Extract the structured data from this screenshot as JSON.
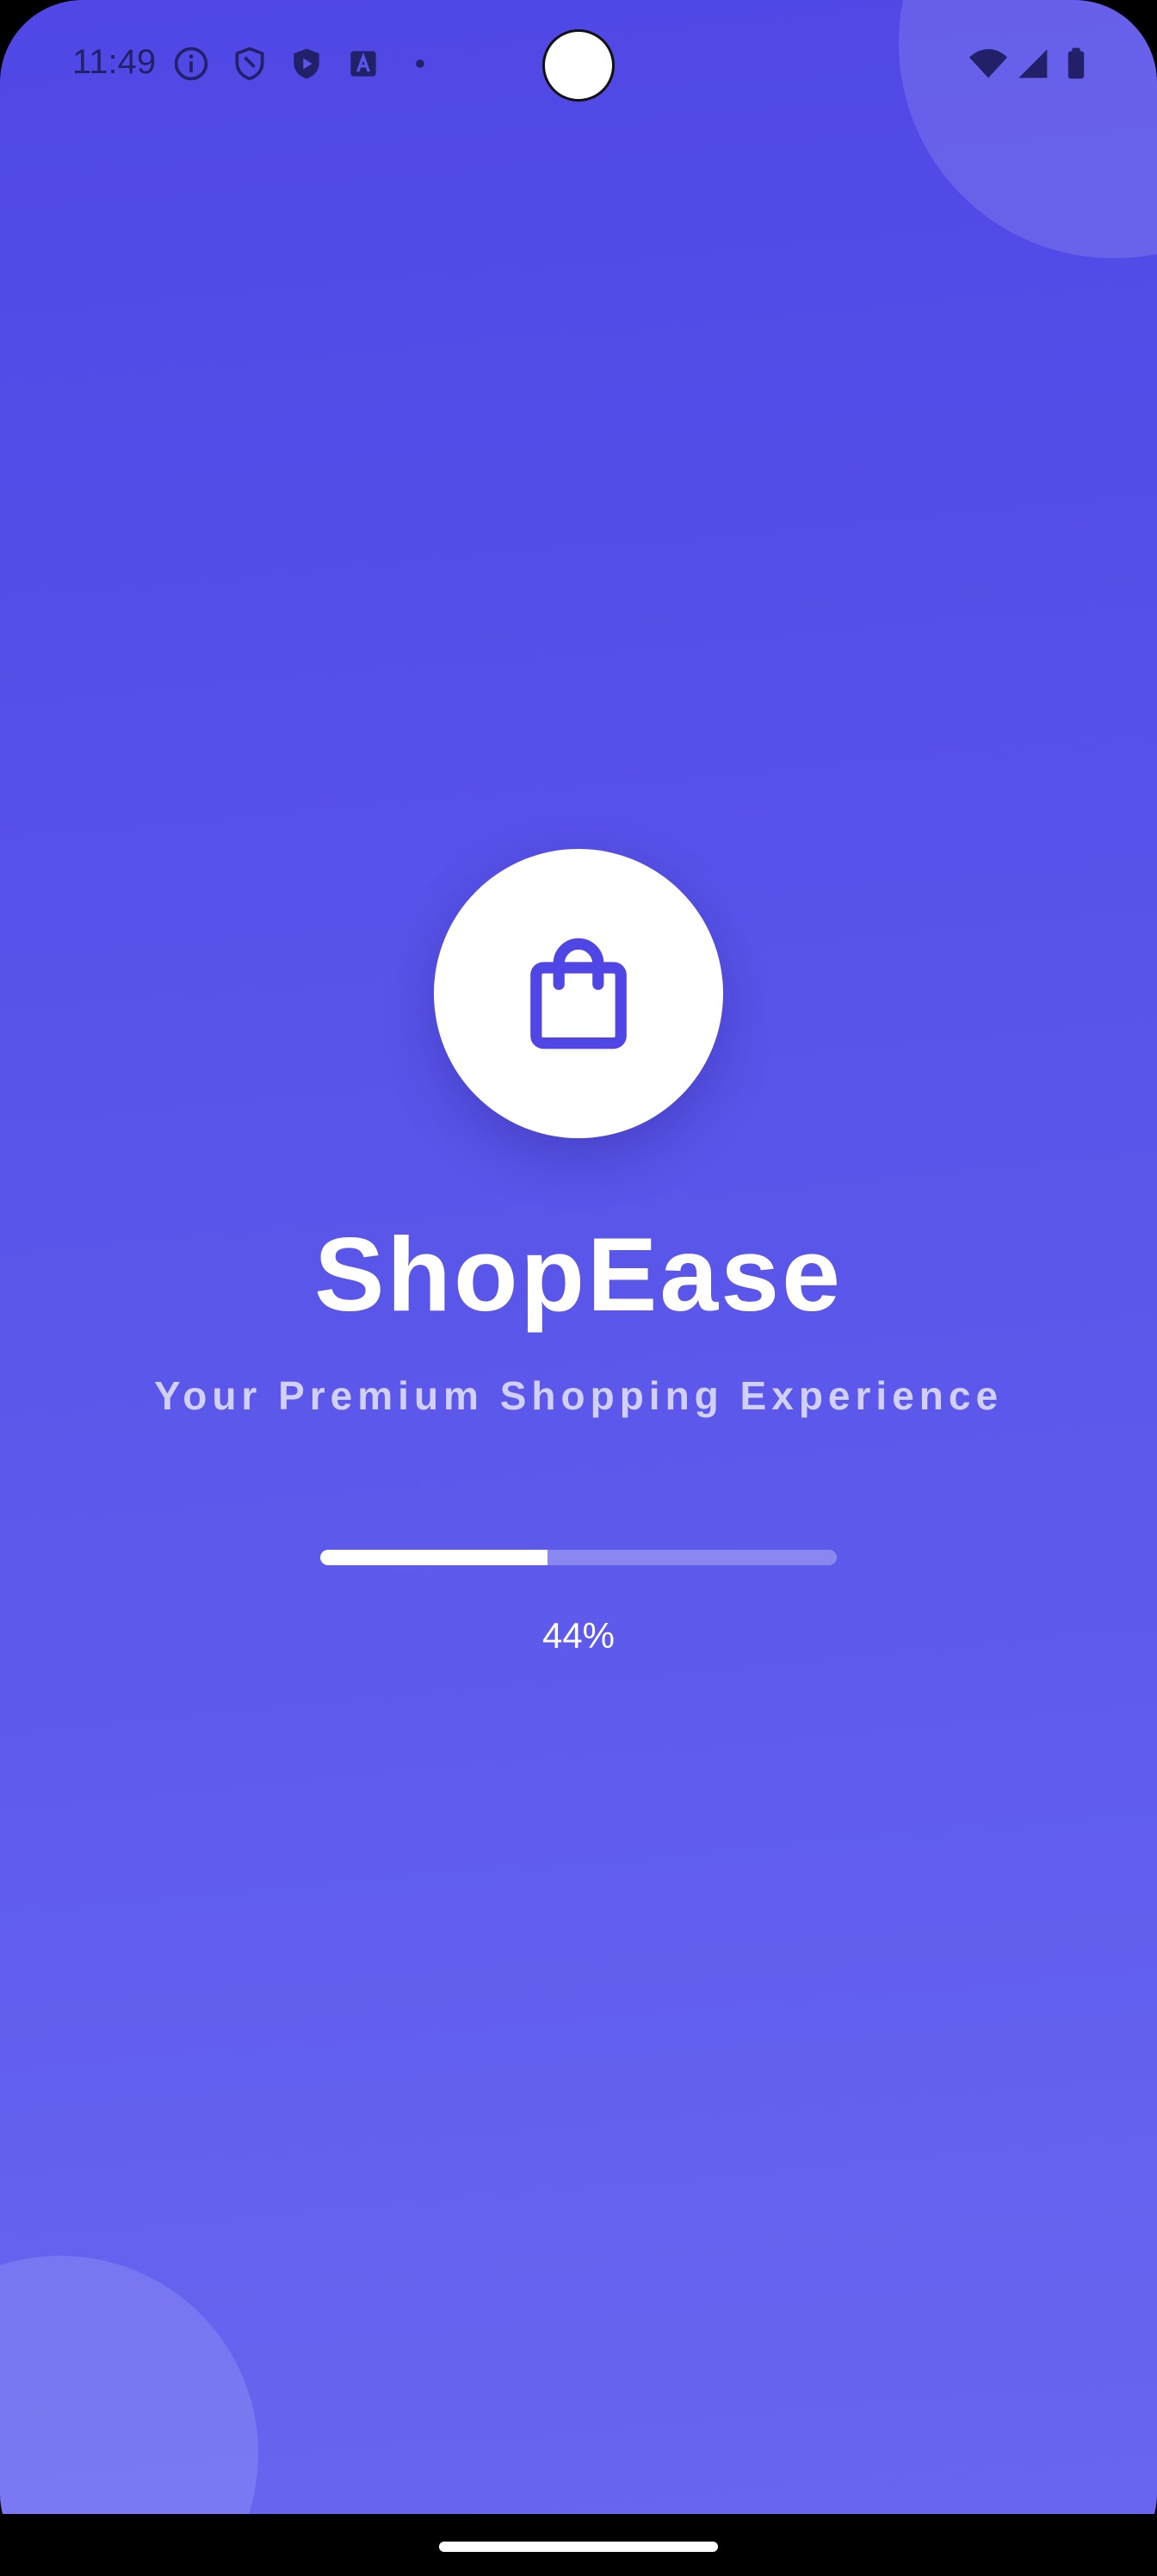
{
  "status_bar": {
    "time": "11:49",
    "left_icons": [
      "info-icon",
      "shield-icon",
      "play-protect-icon",
      "translate-icon",
      "notification-dot-icon"
    ],
    "right_icons": [
      "wifi-icon",
      "cellular-signal-icon",
      "battery-icon"
    ]
  },
  "splash": {
    "logo_icon": "shopping-bag-icon",
    "app_name": "ShopEase",
    "tagline": "Your Premium Shopping Experience",
    "progress_percent": 44,
    "progress_label": "44%"
  },
  "colors": {
    "background_top": "#5047e6",
    "background_bottom": "#6866f0",
    "accent": "#4f46e5",
    "text_primary": "#ffffff"
  }
}
